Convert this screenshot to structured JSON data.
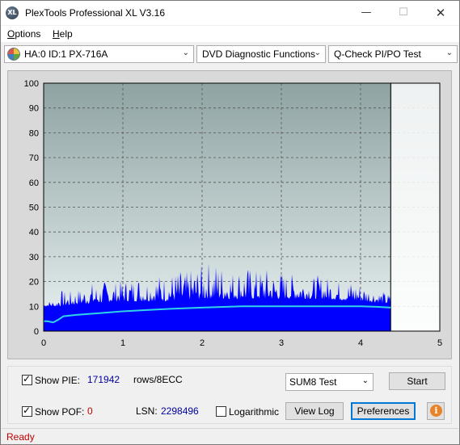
{
  "window": {
    "title": "PlexTools Professional XL V3.16",
    "icon_text": "XL",
    "minimize_glyph": "—",
    "maximize_glyph": "☐",
    "close_glyph": "✕"
  },
  "menu": {
    "items": [
      {
        "label": "Options",
        "accel": "O"
      },
      {
        "label": "Help",
        "accel": "H"
      }
    ]
  },
  "toolbar": {
    "drive_select": "HA:0 ID:1  PX-716A",
    "function_select": "DVD Diagnostic Functions",
    "test_select": "Q-Check PI/PO Test"
  },
  "chart_data": {
    "type": "area",
    "xlabel": "",
    "ylabel": "",
    "xlim": [
      0,
      5
    ],
    "ylim": [
      0,
      100
    ],
    "x_ticks": [
      "0",
      "1",
      "2",
      "3",
      "4",
      "5"
    ],
    "y_ticks": [
      "0",
      "10",
      "20",
      "30",
      "40",
      "50",
      "60",
      "70",
      "80",
      "90",
      "100"
    ],
    "grid": true,
    "data_end_x": 4.38,
    "series": [
      {
        "color": "#0000ff",
        "envelope": [
          [
            0.0,
            11
          ],
          [
            0.05,
            12
          ],
          [
            0.1,
            13
          ],
          [
            0.15,
            11
          ],
          [
            0.2,
            17
          ],
          [
            0.3,
            16
          ],
          [
            0.4,
            17
          ],
          [
            0.5,
            18
          ],
          [
            0.6,
            20
          ],
          [
            0.7,
            19
          ],
          [
            0.8,
            21
          ],
          [
            0.9,
            20
          ],
          [
            1.0,
            21
          ],
          [
            1.1,
            22
          ],
          [
            1.2,
            23
          ],
          [
            1.3,
            22
          ],
          [
            1.4,
            24
          ],
          [
            1.5,
            23
          ],
          [
            1.6,
            24
          ],
          [
            1.7,
            25
          ],
          [
            1.8,
            24
          ],
          [
            1.9,
            26
          ],
          [
            2.0,
            27
          ],
          [
            2.05,
            30
          ],
          [
            2.1,
            28
          ],
          [
            2.2,
            29
          ],
          [
            2.3,
            26
          ],
          [
            2.4,
            25
          ],
          [
            2.5,
            27
          ],
          [
            2.6,
            26
          ],
          [
            2.7,
            25
          ],
          [
            2.8,
            26
          ],
          [
            2.9,
            24
          ],
          [
            3.0,
            25
          ],
          [
            3.1,
            23
          ],
          [
            3.2,
            24
          ],
          [
            3.3,
            23
          ],
          [
            3.4,
            22
          ],
          [
            3.5,
            23
          ],
          [
            3.6,
            22
          ],
          [
            3.7,
            21
          ],
          [
            3.8,
            20
          ],
          [
            3.9,
            21
          ],
          [
            4.0,
            20
          ],
          [
            4.1,
            18
          ],
          [
            4.2,
            17
          ],
          [
            4.3,
            16
          ],
          [
            4.38,
            15
          ]
        ],
        "baseline": [
          [
            0.0,
            10
          ],
          [
            0.2,
            10
          ],
          [
            0.5,
            11
          ],
          [
            1.0,
            12
          ],
          [
            1.5,
            12
          ],
          [
            2.0,
            13
          ],
          [
            2.5,
            13
          ],
          [
            3.0,
            13
          ],
          [
            3.5,
            13
          ],
          [
            4.0,
            12
          ],
          [
            4.38,
            11
          ]
        ]
      },
      {
        "color": "#2fd4e6",
        "values": [
          [
            0.0,
            4
          ],
          [
            0.05,
            4
          ],
          [
            0.12,
            3.5
          ],
          [
            0.18,
            4.5
          ],
          [
            0.25,
            6
          ],
          [
            0.4,
            6.5
          ],
          [
            0.6,
            7
          ],
          [
            0.8,
            7.5
          ],
          [
            1.0,
            8
          ],
          [
            1.3,
            8.5
          ],
          [
            1.6,
            9
          ],
          [
            2.0,
            9.5
          ],
          [
            2.5,
            10
          ],
          [
            3.0,
            10
          ],
          [
            3.5,
            10
          ],
          [
            4.0,
            10
          ],
          [
            4.2,
            9.8
          ],
          [
            4.38,
            9.5
          ]
        ]
      }
    ]
  },
  "bottom": {
    "show_pie_label": "Show PIE:",
    "show_pie_checked": true,
    "pie_value": "171942",
    "rows_label": "rows/8ECC",
    "show_pof_label": "Show POF:",
    "show_pof_checked": true,
    "pof_value": "0",
    "lsn_label": "LSN:",
    "lsn_value": "2298496",
    "logarithmic_label": "Logarithmic",
    "logarithmic_checked": false,
    "sum_select": "SUM8 Test",
    "start_label": "Start",
    "view_log_label": "View Log",
    "preferences_label": "Preferences",
    "info_glyph": "i",
    "chevron_glyph": "⌄"
  },
  "status": {
    "text": "Ready"
  },
  "colors": {
    "plot_top": "#8fa3a3",
    "plot_bottom": "#e8f0f0",
    "bar_fill": "#0000ff",
    "line": "#2fd4e6",
    "status_text": "#c00000"
  }
}
